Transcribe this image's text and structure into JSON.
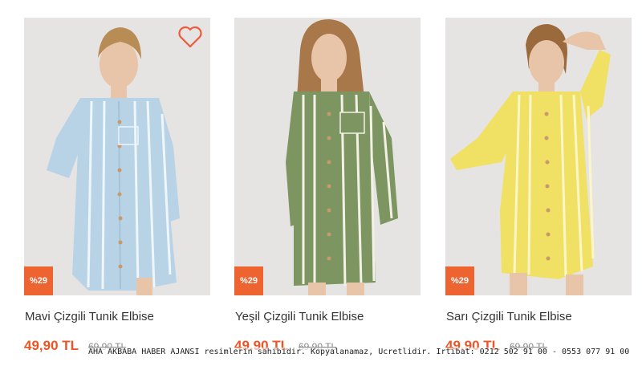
{
  "products": [
    {
      "name": "Mavi Çizgili Tunik Elbise",
      "price": "49,90 TL",
      "old_price": "69,90 TL",
      "discount": "%29",
      "color": "#b9d3e6",
      "stripe": "#eef5fb"
    },
    {
      "name": "Yeşil Çizgili Tunik Elbise",
      "price": "49.90 TL",
      "old_price": "69.90 TL",
      "discount": "%29",
      "color": "#7d9561",
      "stripe": "#f3f1e6"
    },
    {
      "name": "Sarı Çizgili Tunik Elbise",
      "price": "49.90 TL",
      "old_price": "69.90 TL",
      "discount": "%29",
      "color": "#f0e064",
      "stripe": "#fbf6c8"
    }
  ],
  "watermark": "AHA AKBABA HABER AJANSI resimlerin sahibidir. Kopyalanamaz, Ucretlidir. Irtibat: 0212 502 91 00  - 0553 077 91 00",
  "colors": {
    "accent": "#ee6431",
    "price": "#ee5424"
  },
  "icons": {
    "favorite": "heart-icon"
  }
}
